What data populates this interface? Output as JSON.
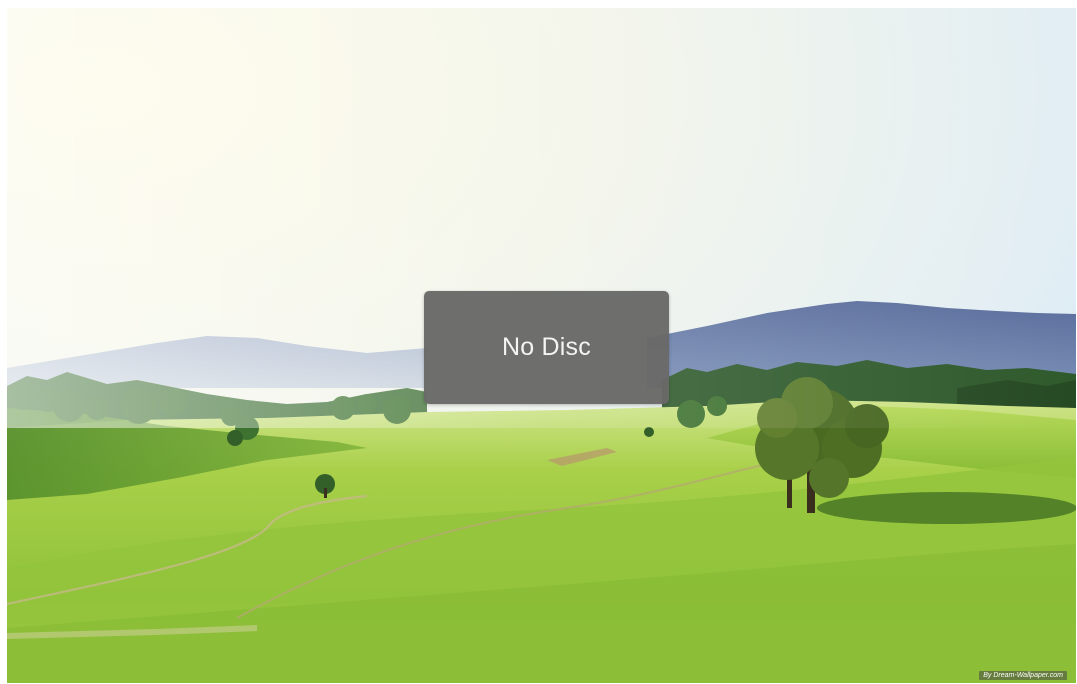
{
  "notification": {
    "message": "No Disc"
  },
  "wallpaper": {
    "credit": "By Dream-Wallpaper.com"
  },
  "colors": {
    "overlay_background": "#696967",
    "overlay_text": "#f4f4f4",
    "sky_top": "#fbf7dc",
    "sky_right": "#dcedf6",
    "mountains": "#5c6e9c",
    "grass": "#9bc73a",
    "grass_dark": "#5e8a24"
  }
}
